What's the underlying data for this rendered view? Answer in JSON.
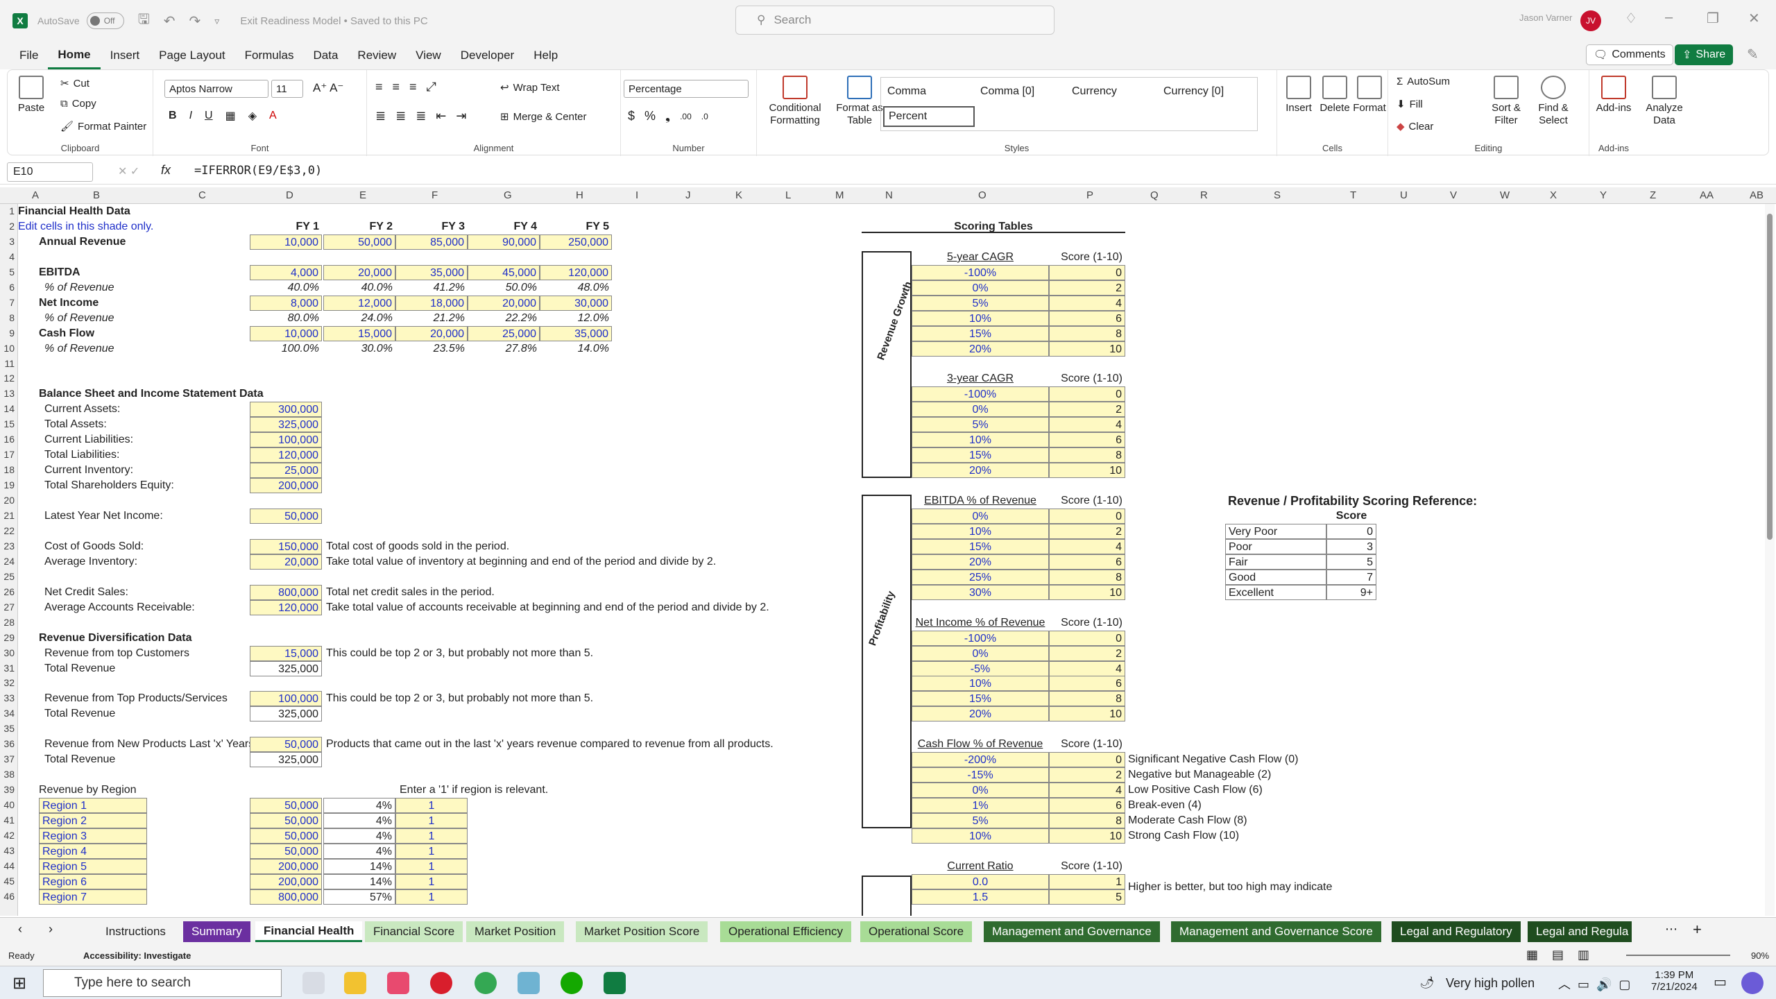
{
  "app": {
    "logo": "X",
    "autosave": "AutoSave",
    "autosave_state": "Off",
    "doc_title": "Exit Readiness Model • Saved to this PC",
    "search_placeholder": "Search",
    "user_name": "Jason Varner",
    "user_initials": "JV"
  },
  "menu": {
    "items": [
      "File",
      "Home",
      "Insert",
      "Page Layout",
      "Formulas",
      "Data",
      "Review",
      "View",
      "Developer",
      "Help"
    ],
    "comments": "Comments",
    "share": "Share"
  },
  "ribbon": {
    "clipboard": {
      "paste": "Paste",
      "cut": "Cut",
      "copy": "Copy",
      "format_painter": "Format Painter",
      "label": "Clipboard"
    },
    "font": {
      "name": "Aptos Narrow",
      "size": "11",
      "label": "Font"
    },
    "alignment": {
      "wrap": "Wrap Text",
      "merge": "Merge & Center",
      "label": "Alignment"
    },
    "number": {
      "format": "Percentage",
      "label": "Number"
    },
    "styles": {
      "conditional": "Conditional Formatting",
      "format_table": "Format as Table",
      "s1": "Comma",
      "s2": "Comma [0]",
      "s3": "Currency",
      "s4": "Currency [0]",
      "s5": "Percent",
      "label": "Styles"
    },
    "cells": {
      "insert": "Insert",
      "delete": "Delete",
      "format": "Format",
      "label": "Cells"
    },
    "editing": {
      "autosum": "AutoSum",
      "fill": "Fill",
      "clear": "Clear",
      "sort": "Sort & Filter",
      "find": "Find & Select",
      "label": "Editing"
    },
    "addins": {
      "addins": "Add-ins",
      "analyze": "Analyze Data",
      "label": "Add-ins"
    }
  },
  "formula_bar": {
    "cell": "E10",
    "fx": "fx",
    "formula": "=IFERROR(E9/E$3,0)"
  },
  "columns": [
    "A",
    "B",
    "C",
    "D",
    "E",
    "F",
    "G",
    "H",
    "I",
    "J",
    "K",
    "L",
    "M",
    "N",
    "O",
    "P",
    "Q",
    "R",
    "S",
    "T",
    "U",
    "V",
    "W",
    "X",
    "Y",
    "Z",
    "AA",
    "AB"
  ],
  "sheet": {
    "title": "Financial Health Data",
    "edit_note": "Edit cells in this shade only.",
    "fy_headers": [
      "FY 1",
      "FY 2",
      "FY 3",
      "FY 4",
      "FY 5"
    ],
    "annual_revenue": {
      "label": "Annual Revenue",
      "values": [
        "10,000",
        "50,000",
        "85,000",
        "90,000",
        "250,000"
      ]
    },
    "ebitda": {
      "label": "EBITDA",
      "values": [
        "4,000",
        "20,000",
        "35,000",
        "45,000",
        "120,000"
      ]
    },
    "ebitda_pct": {
      "label": "% of Revenue",
      "values": [
        "40.0%",
        "40.0%",
        "41.2%",
        "50.0%",
        "48.0%"
      ]
    },
    "net_income": {
      "label": "Net Income",
      "values": [
        "8,000",
        "12,000",
        "18,000",
        "20,000",
        "30,000"
      ]
    },
    "ni_pct": {
      "label": "% of Revenue",
      "values": [
        "80.0%",
        "24.0%",
        "21.2%",
        "22.2%",
        "12.0%"
      ]
    },
    "cash_flow": {
      "label": "Cash Flow",
      "values": [
        "10,000",
        "15,000",
        "20,000",
        "25,000",
        "35,000"
      ]
    },
    "cf_pct": {
      "label": "% of Revenue",
      "values": [
        "100.0%",
        "30.0%",
        "23.5%",
        "27.8%",
        "14.0%"
      ]
    },
    "bs_title": "Balance Sheet and Income Statement Data",
    "bs_rows": [
      [
        "Current Assets:",
        "300,000"
      ],
      [
        "Total Assets:",
        "325,000"
      ],
      [
        "Current Liabilities:",
        "100,000"
      ],
      [
        "Total Liabilities:",
        "120,000"
      ],
      [
        "Current Inventory:",
        "25,000"
      ],
      [
        "Total Shareholders Equity:",
        "200,000"
      ]
    ],
    "latest_ni": [
      "Latest Year Net Income:",
      "50,000"
    ],
    "cogs": [
      "Cost of Goods Sold:",
      "150,000",
      "Total cost of goods sold in the period."
    ],
    "avg_inv": [
      "Average Inventory:",
      "20,000",
      "Take total value of inventory at beginning and end of the period and divide by 2."
    ],
    "credit_sales": [
      "Net Credit Sales:",
      "800,000",
      "Total net credit sales in the period."
    ],
    "avg_ar": [
      "Average Accounts Receivable:",
      "120,000",
      "Take total value of accounts receivable at beginning and end of the period and divide by 2."
    ],
    "div_title": "Revenue Diversification Data",
    "top_cust": [
      "Revenue from top Customers",
      "15,000",
      "This could be top 2 or 3, but probably not more than 5."
    ],
    "total_rev1": [
      "Total Revenue",
      "325,000"
    ],
    "top_prod": [
      "Revenue from Top Products/Services",
      "100,000",
      "This could be top 2 or 3, but probably not more than 5."
    ],
    "total_rev2": [
      "Total Revenue",
      "325,000"
    ],
    "new_prod": [
      "Revenue from New Products Last 'x' Years",
      "50,000",
      "Products that came out in the last 'x' years revenue compared to revenue from all products."
    ],
    "total_rev3": [
      "Total Revenue",
      "325,000"
    ],
    "region_title": "Revenue by Region",
    "region_note": "Enter a '1' if region is relevant.",
    "regions": [
      [
        "Region 1",
        "50,000",
        "4%",
        "1"
      ],
      [
        "Region 2",
        "50,000",
        "4%",
        "1"
      ],
      [
        "Region 3",
        "50,000",
        "4%",
        "1"
      ],
      [
        "Region 4",
        "50,000",
        "4%",
        "1"
      ],
      [
        "Region 5",
        "200,000",
        "14%",
        "1"
      ],
      [
        "Region 6",
        "200,000",
        "14%",
        "1"
      ],
      [
        "Region 7",
        "800,000",
        "57%",
        "1"
      ]
    ],
    "scoring_title": "Scoring Tables",
    "score_hdr": "Score (1-10)",
    "growth_label": "Revenue Growth",
    "profit_label": "Profitability",
    "cagr5": {
      "title": "5-year CAGR",
      "rows": [
        [
          "-100%",
          "0"
        ],
        [
          "0%",
          "2"
        ],
        [
          "5%",
          "4"
        ],
        [
          "10%",
          "6"
        ],
        [
          "15%",
          "8"
        ],
        [
          "20%",
          "10"
        ]
      ]
    },
    "cagr3": {
      "title": "3-year CAGR",
      "rows": [
        [
          "-100%",
          "0"
        ],
        [
          "0%",
          "2"
        ],
        [
          "5%",
          "4"
        ],
        [
          "10%",
          "6"
        ],
        [
          "15%",
          "8"
        ],
        [
          "20%",
          "10"
        ]
      ]
    },
    "ebitda_tbl": {
      "title": "EBITDA % of Revenue",
      "rows": [
        [
          "0%",
          "0"
        ],
        [
          "10%",
          "2"
        ],
        [
          "15%",
          "4"
        ],
        [
          "20%",
          "6"
        ],
        [
          "25%",
          "8"
        ],
        [
          "30%",
          "10"
        ]
      ]
    },
    "ni_tbl": {
      "title": "Net Income % of Revenue",
      "rows": [
        [
          "-100%",
          "0"
        ],
        [
          "0%",
          "2"
        ],
        [
          "-5%",
          "4"
        ],
        [
          "10%",
          "6"
        ],
        [
          "15%",
          "8"
        ],
        [
          "20%",
          "10"
        ]
      ]
    },
    "cf_tbl": {
      "title": "Cash Flow % of Revenue",
      "rows": [
        [
          "-200%",
          "0",
          "Significant Negative Cash Flow (0)"
        ],
        [
          "-15%",
          "2",
          "Negative but Manageable (2)"
        ],
        [
          "0%",
          "4",
          "Low Positive Cash Flow (6)"
        ],
        [
          "1%",
          "6",
          "Break-even (4)"
        ],
        [
          "5%",
          "8",
          "Moderate Cash Flow (8)"
        ],
        [
          "10%",
          "10",
          "Strong Cash Flow (10)"
        ]
      ]
    },
    "cr_tbl": {
      "title": "Current Ratio",
      "rows": [
        [
          "0.0",
          "1"
        ],
        [
          "1.5",
          "5"
        ]
      ],
      "note": "Higher is better, but too high may indicate"
    },
    "ref": {
      "title": "Revenue / Profitability Scoring Reference:",
      "score": "Score",
      "rows": [
        [
          "Very Poor",
          "0"
        ],
        [
          "Poor",
          "3"
        ],
        [
          "Fair",
          "5"
        ],
        [
          "Good",
          "7"
        ],
        [
          "Excellent",
          "9+"
        ]
      ]
    }
  },
  "tabs": [
    "Instructions",
    "Summary",
    "Financial Health",
    "Financial Score",
    "Market Position",
    "Market Position Score",
    "Operational Efficiency",
    "Operational Score",
    "Management and Governance",
    "Management and Governance Score",
    "Legal and Regulatory",
    "Legal and Regula"
  ],
  "status": {
    "ready": "Ready",
    "accessibility": "Accessibility: Investigate",
    "zoom": "90%"
  },
  "taskbar": {
    "search": "Type here to search",
    "weather": "Very high pollen",
    "time": "1:39 PM",
    "date": "7/21/2024"
  }
}
